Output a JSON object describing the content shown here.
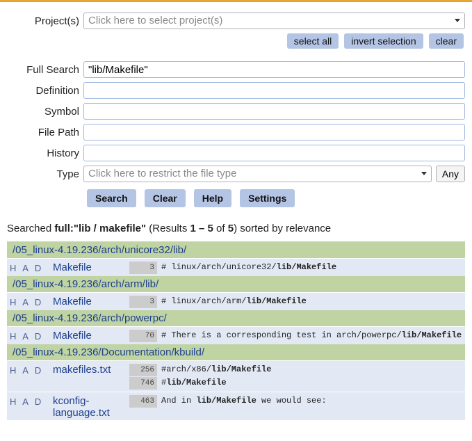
{
  "form": {
    "projects": {
      "label": "Project(s)",
      "placeholder": "Click here to select project(s)"
    },
    "proj_btns": {
      "select_all": "select all",
      "invert": "invert selection",
      "clear": "clear"
    },
    "full_search": {
      "label": "Full Search",
      "value": "\"lib/Makefile\""
    },
    "definition": {
      "label": "Definition",
      "value": ""
    },
    "symbol": {
      "label": "Symbol",
      "value": ""
    },
    "file_path": {
      "label": "File Path",
      "value": ""
    },
    "history": {
      "label": "History",
      "value": ""
    },
    "type": {
      "label": "Type",
      "placeholder": "Click here to restrict the file type",
      "any": "Any"
    },
    "buttons": {
      "search": "Search",
      "clear": "Clear",
      "help": "Help",
      "settings": "Settings"
    }
  },
  "summary": {
    "prefix": "Searched ",
    "query": "full:\"lib / makefile\"",
    "mid1": " (Results ",
    "range": "1 – 5",
    "mid2": " of ",
    "total": "5",
    "suffix": ") sorted by relevance"
  },
  "results": [
    {
      "dir": "/05_linux-4.19.236/arch/unicore32/lib/",
      "files": [
        {
          "had": "H A D",
          "name": "Makefile",
          "matches": [
            {
              "line": "3",
              "pre": "# linux/arch/unicore32/",
              "hit": "lib/Makefile",
              "post": ""
            }
          ]
        }
      ]
    },
    {
      "dir": "/05_linux-4.19.236/arch/arm/lib/",
      "files": [
        {
          "had": "H A D",
          "name": "Makefile",
          "matches": [
            {
              "line": "3",
              "pre": "# linux/arch/arm/",
              "hit": "lib/Makefile",
              "post": ""
            }
          ]
        }
      ]
    },
    {
      "dir": "/05_linux-4.19.236/arch/powerpc/",
      "files": [
        {
          "had": "H A D",
          "name": "Makefile",
          "matches": [
            {
              "line": "70",
              "pre": "# There is a corresponding test in arch/powerpc/",
              "hit": "lib/Makefile",
              "post": ""
            }
          ]
        }
      ]
    },
    {
      "dir": "/05_linux-4.19.236/Documentation/kbuild/",
      "files": [
        {
          "had": "H A D",
          "name": "makefiles.txt",
          "matches": [
            {
              "line": "256",
              "pre": "#arch/x86/",
              "hit": "lib/Makefile",
              "post": ""
            },
            {
              "line": "746",
              "pre": "#",
              "hit": "lib/Makefile",
              "post": ""
            }
          ]
        },
        {
          "had": "H A D",
          "name": "kconfig-language.txt",
          "matches": [
            {
              "line": "463",
              "pre": "And in ",
              "hit": "lib/Makefile",
              "post": " we would see:"
            }
          ]
        }
      ]
    }
  ]
}
